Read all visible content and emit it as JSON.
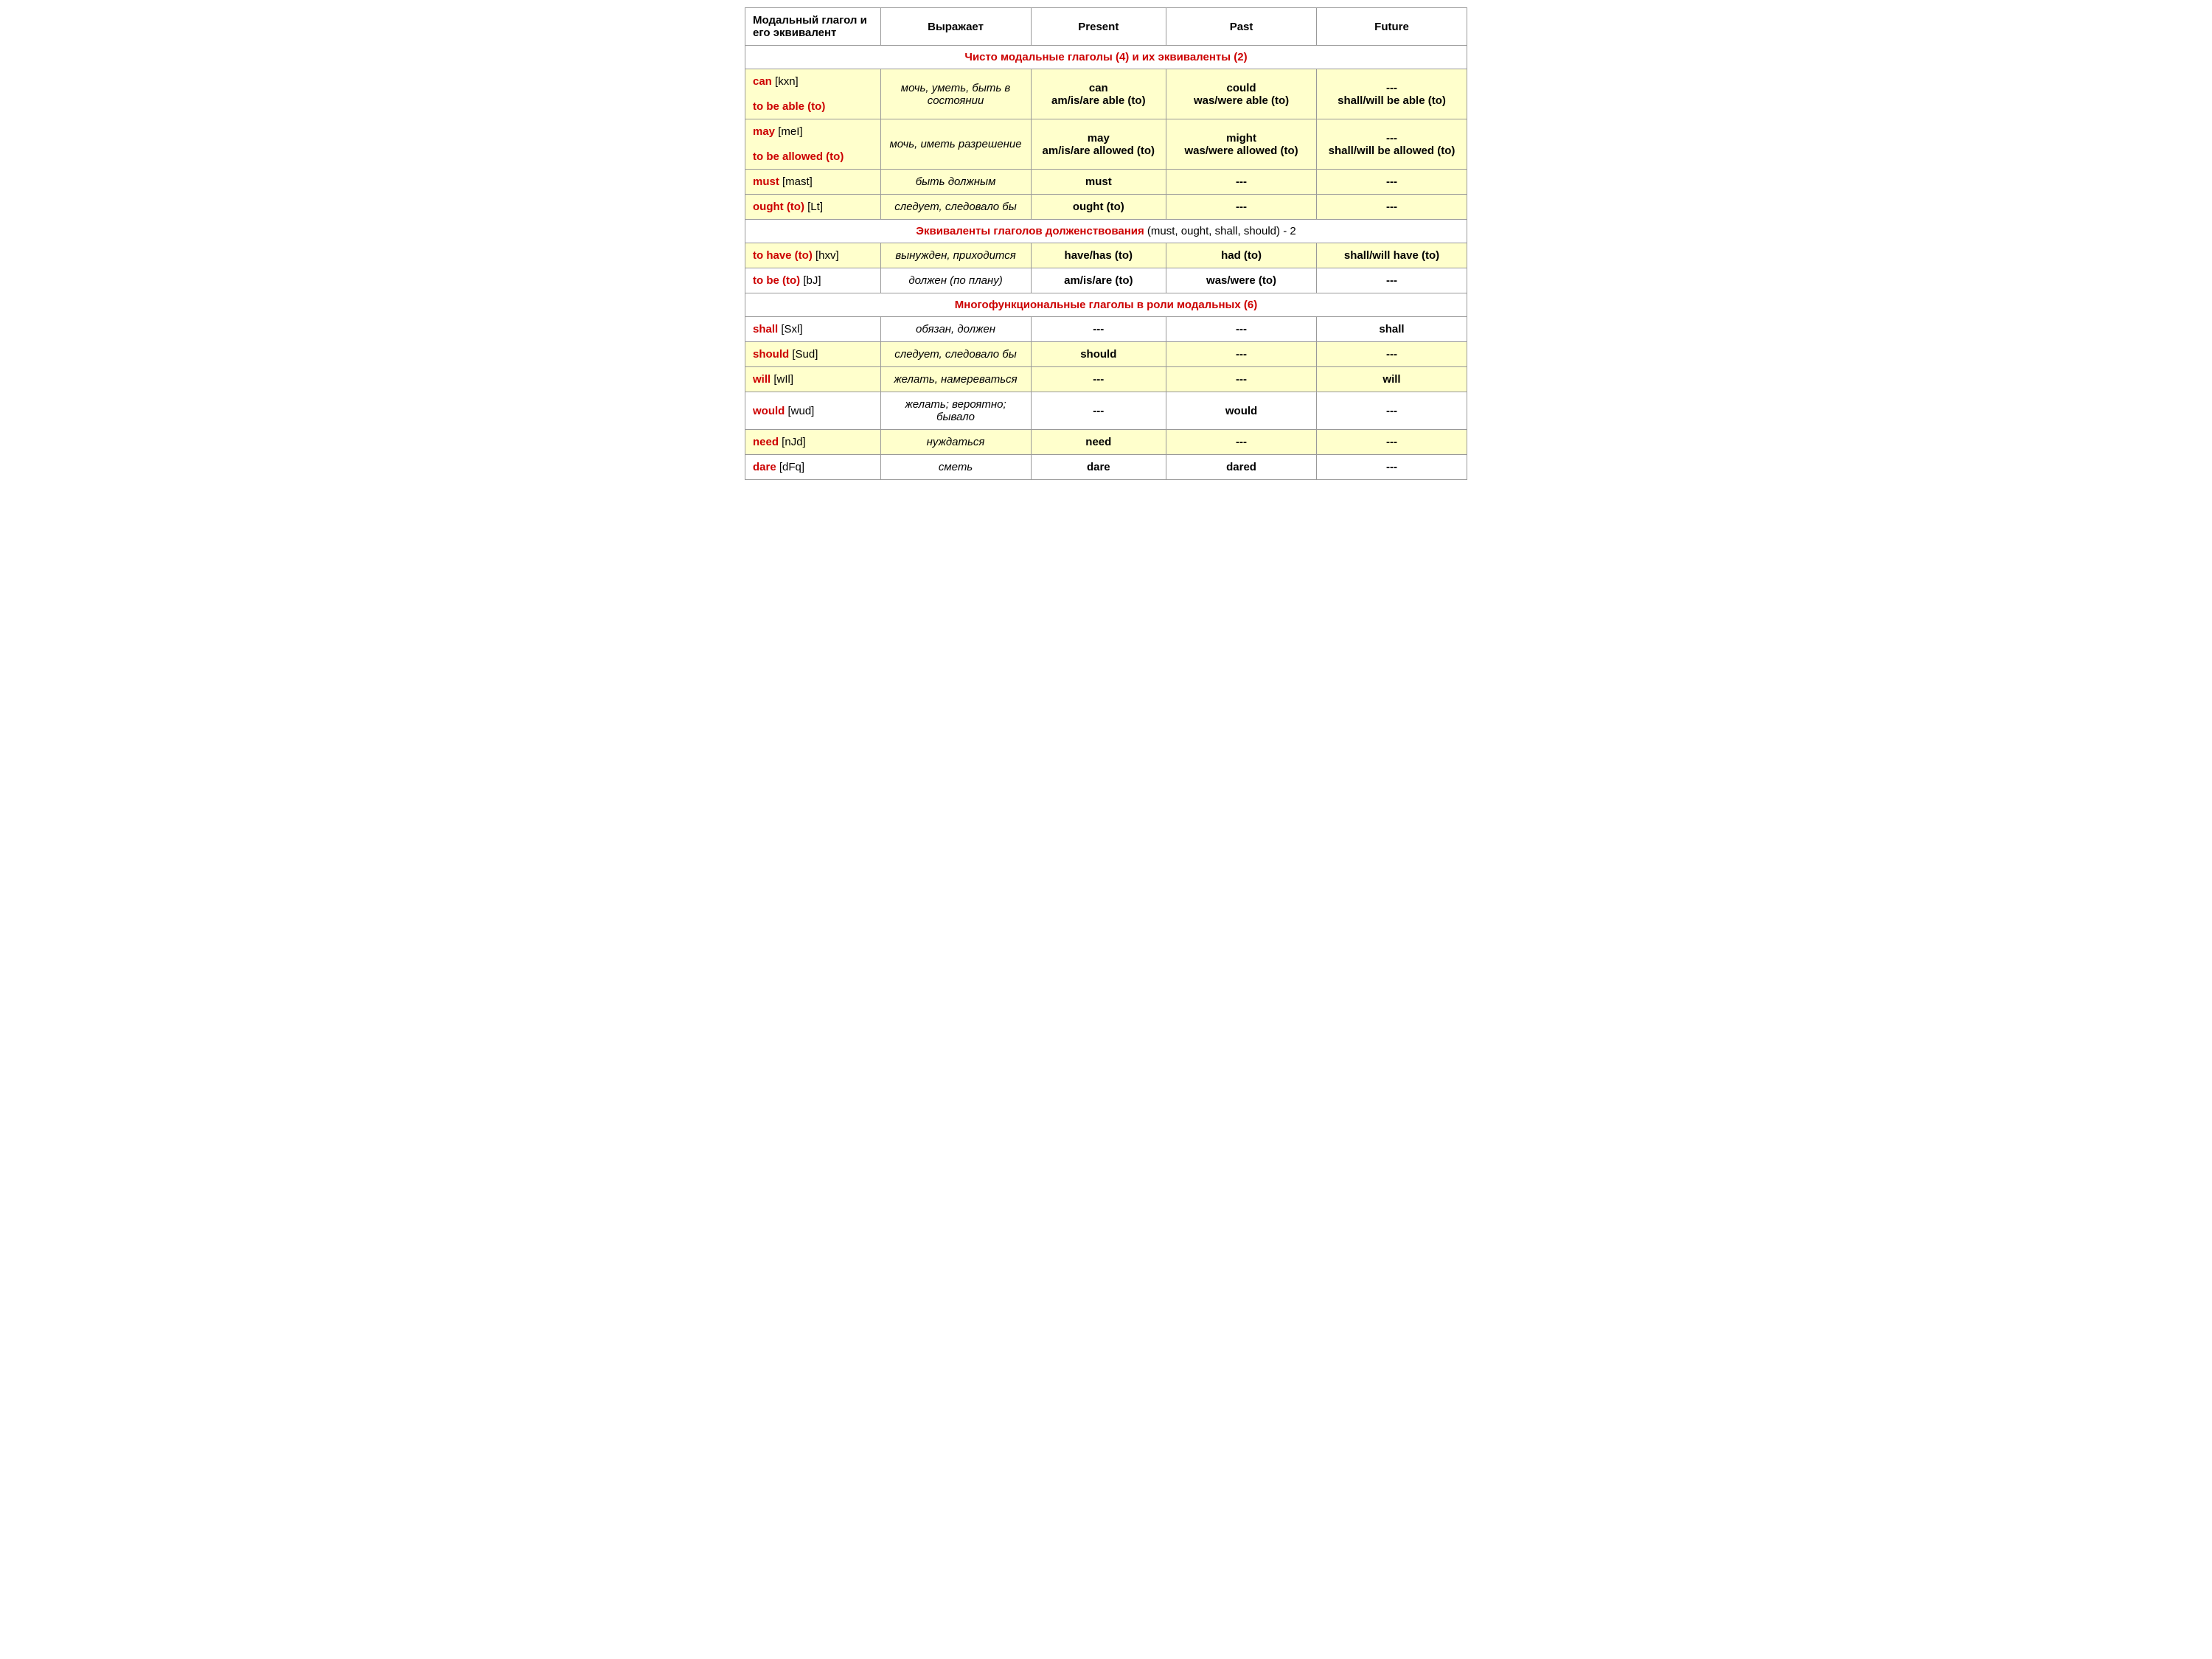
{
  "table": {
    "headers": {
      "col1": "Модальный глагол и его эквивалент",
      "col2": "Выражает",
      "col3": "Present",
      "col4": "Past",
      "col5": "Future"
    },
    "sections": [
      {
        "type": "section-header",
        "text_red": "Чисто модальные глаголы (4) и их эквиваленты (2)",
        "text_black": ""
      },
      {
        "type": "data-row",
        "bg": "yellow",
        "col1_main": "can",
        "col1_trans": "[kxn]",
        "col1_equiv": "to be able (to)",
        "col2": "мочь, уметь, быть в состоянии",
        "col3": "can\nam/is/are able (to)",
        "col4": "could\nwas/were able (to)",
        "col5": "---\nshall/will be able (to)"
      },
      {
        "type": "data-row",
        "bg": "yellow",
        "col1_main": "may",
        "col1_trans": "[meI]",
        "col1_equiv": "to be allowed (to)",
        "col2": "мочь, иметь разрешение",
        "col3": "may\nam/is/are allowed (to)",
        "col4": "might\nwas/were allowed (to)",
        "col5": "---\nshall/will be allowed (to)"
      },
      {
        "type": "data-row",
        "bg": "yellow",
        "col1_main": "must",
        "col1_trans": "[mast]",
        "col1_equiv": "",
        "col2": "быть должным",
        "col3": "must",
        "col4": "---",
        "col5": "---"
      },
      {
        "type": "data-row",
        "bg": "yellow",
        "col1_main": "ought (to)",
        "col1_trans": "[Lt]",
        "col1_equiv": "",
        "col2": "следует, следовало бы",
        "col3": "ought (to)",
        "col4": "---",
        "col5": "---"
      },
      {
        "type": "section-header",
        "text_red": "Эквиваленты глаголов долженствования",
        "text_black": " (must, ought, shall, should) - 2"
      },
      {
        "type": "data-row",
        "bg": "yellow",
        "col1_main": "to have (to)",
        "col1_trans": "[hxv]",
        "col1_equiv": "",
        "col2": "вынужден, приходится",
        "col3": "have/has (to)",
        "col4": "had (to)",
        "col5": "shall/will have (to)"
      },
      {
        "type": "data-row",
        "bg": "white",
        "col1_main": "to be (to)",
        "col1_trans": "[bJ]",
        "col1_equiv": "",
        "col2": "должен (по плану)",
        "col3": "am/is/are (to)",
        "col4": "was/were (to)",
        "col5": "---"
      },
      {
        "type": "section-header",
        "text_red": "Многофункциональные глаголы в роли модальных (6)",
        "text_black": ""
      },
      {
        "type": "data-row",
        "bg": "white",
        "col1_main": "shall",
        "col1_trans": "[Sxl]",
        "col1_equiv": "",
        "col2": "обязан, должен",
        "col3": "---",
        "col4": "---",
        "col5": "shall"
      },
      {
        "type": "data-row",
        "bg": "yellow",
        "col1_main": "should",
        "col1_trans": "[Sud]",
        "col1_equiv": "",
        "col2": "следует, следовало бы",
        "col3": "should",
        "col4": "---",
        "col5": "---"
      },
      {
        "type": "data-row",
        "bg": "yellow",
        "col1_main": "will",
        "col1_trans": "[wIl]",
        "col1_equiv": "",
        "col2": "желать, намереваться",
        "col3": "---",
        "col4": "---",
        "col5": "will"
      },
      {
        "type": "data-row",
        "bg": "white",
        "col1_main": "would",
        "col1_trans": "[wud]",
        "col1_equiv": "",
        "col2": "желать; вероятно; бывало",
        "col3": "---",
        "col4": "would",
        "col5": "---"
      },
      {
        "type": "data-row",
        "bg": "yellow",
        "col1_main": "need",
        "col1_trans": "[nJd]",
        "col1_equiv": "",
        "col2": "нуждаться",
        "col3": "need",
        "col4": "---",
        "col5": "---"
      },
      {
        "type": "data-row",
        "bg": "white",
        "col1_main": "dare",
        "col1_trans": "[dFq]",
        "col1_equiv": "",
        "col2": "сметь",
        "col3": "dare",
        "col4": "dared",
        "col5": "---"
      }
    ]
  }
}
